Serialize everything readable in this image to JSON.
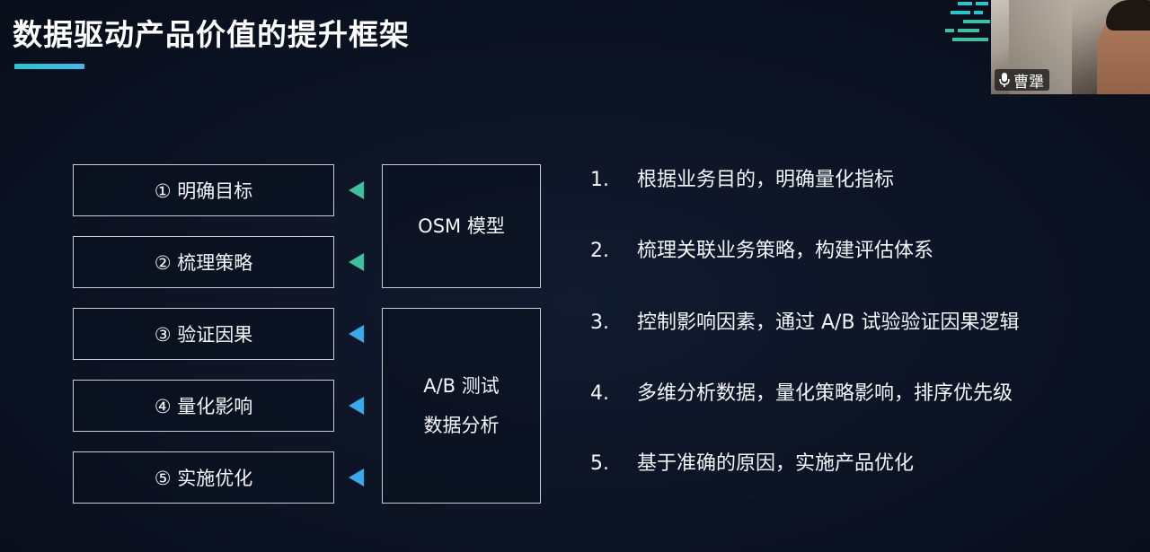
{
  "slide": {
    "title": "数据驱动产品价值的提升框架",
    "accent_color": "#2ac4cf"
  },
  "steps": [
    {
      "label": "① 明确目标"
    },
    {
      "label": "② 梳理策略"
    },
    {
      "label": "③ 验证因果"
    },
    {
      "label": "④ 量化影响"
    },
    {
      "label": "⑤ 实施优化"
    }
  ],
  "groups": [
    {
      "lines": [
        "OSM 模型"
      ],
      "arrow_color": "#3fbf9d"
    },
    {
      "lines": [
        "A/B 测试",
        "数据分析"
      ],
      "arrow_color": "#3aa9e6"
    }
  ],
  "list": [
    {
      "num": "1.",
      "text": "根据业务目的，明确量化指标"
    },
    {
      "num": "2.",
      "text": "梳理关联业务策略，构建评估体系"
    },
    {
      "num": "3.",
      "text": "控制影响因素，通过 A/B 试验验证因果逻辑"
    },
    {
      "num": "4.",
      "text": "多维分析数据，量化策略影响，排序优先级"
    },
    {
      "num": "5.",
      "text": "基于准确的原因，实施产品优化"
    }
  ],
  "video": {
    "speaker_name": "曹犟",
    "icon": "microphone-icon"
  }
}
